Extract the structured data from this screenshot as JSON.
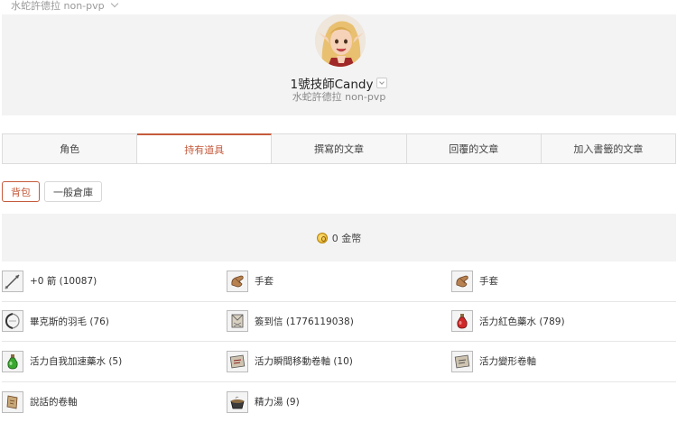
{
  "server_select": {
    "label": "水蛇許德拉 non-pvp"
  },
  "profile": {
    "name": "1號技師Candy",
    "server": "水蛇許德拉 non-pvp"
  },
  "tabs": [
    {
      "label": "角色"
    },
    {
      "label": "持有道具"
    },
    {
      "label": "撰寫的文章"
    },
    {
      "label": "回覆的文章"
    },
    {
      "label": "加入書籤的文章"
    }
  ],
  "subtabs": [
    {
      "label": "背包"
    },
    {
      "label": "一般倉庫"
    }
  ],
  "gold": {
    "text": "0 金幣"
  },
  "items": [
    {
      "label": "+0 箭 (10087)",
      "icon": "arrow-icon"
    },
    {
      "label": "手套",
      "icon": "glove-icon"
    },
    {
      "label": "手套",
      "icon": "glove-icon"
    },
    {
      "label": "畢克斯的羽毛 (76)",
      "icon": "feather-icon"
    },
    {
      "label": "簽到信 (1776119038)",
      "icon": "letter-icon"
    },
    {
      "label": "活力紅色藥水 (789)",
      "icon": "red-potion-icon"
    },
    {
      "label": "活力自我加速藥水 (5)",
      "icon": "green-potion-icon"
    },
    {
      "label": "活力瞬間移動卷軸 (10)",
      "icon": "scroll-icon"
    },
    {
      "label": "活力變形卷軸",
      "icon": "scroll-icon"
    },
    {
      "label": "說話的卷軸",
      "icon": "talking-scroll-icon"
    },
    {
      "label": "精力湯 (9)",
      "icon": "soup-icon"
    }
  ]
}
